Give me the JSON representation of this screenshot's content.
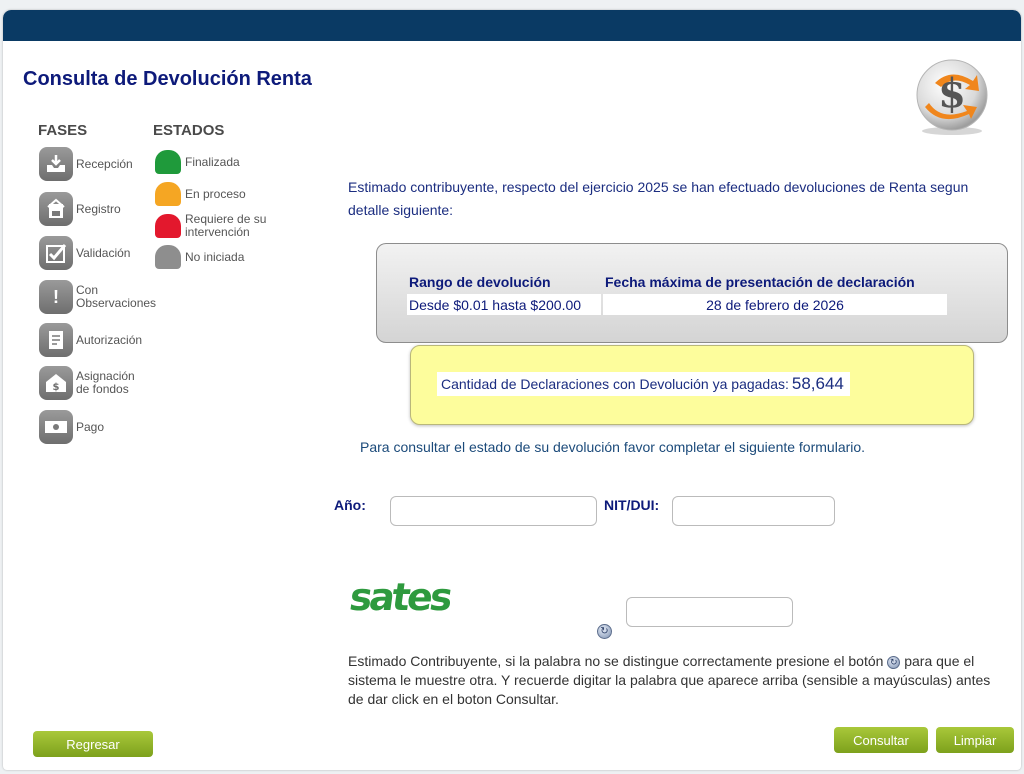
{
  "page_title": "Consulta de Devolución Renta",
  "legend": {
    "phases_title": "FASES",
    "states_title": "ESTADOS",
    "phases": [
      {
        "label": "Recepción",
        "icon": "inbox-tray-icon"
      },
      {
        "label": "Registro",
        "icon": "registry-icon"
      },
      {
        "label": "Validación",
        "icon": "checkbox-icon"
      },
      {
        "label": "Con Observaciones",
        "icon": "exclamation-icon"
      },
      {
        "label": "Autorización",
        "icon": "document-icon"
      },
      {
        "label": "Asignación de fondos",
        "icon": "money-house-icon"
      },
      {
        "label": "Pago",
        "icon": "banknote-icon"
      }
    ],
    "states": [
      {
        "label": "Finalizada",
        "color": "#1f9a3b"
      },
      {
        "label": "En proceso",
        "color": "#f5a623"
      },
      {
        "label": "Requiere de su intervención",
        "color": "#e3182d"
      },
      {
        "label": "No iniciada",
        "color": "#8e8e8e"
      }
    ]
  },
  "intro_text": "Estimado contribuyente, respecto del ejercicio 2025 se han efectuado devoluciones de Renta segun detalle siguiente:",
  "table": {
    "headers": [
      "Rango de devolución",
      "Fecha máxima de presentación de declaración"
    ],
    "rows": [
      [
        "Desde $0.01 hasta $200.00",
        "28 de febrero de 2026"
      ]
    ]
  },
  "paid": {
    "label": "Cantidad de Declaraciones con Devolución ya pagadas:",
    "value": "58,644"
  },
  "form": {
    "instructions": "Para consultar el estado de su devolución favor completar el siguiente formulario.",
    "year_label": "Año:",
    "year_value": "",
    "nit_label": "NIT/DUI:",
    "nit_value": "",
    "captcha_value": "",
    "captcha_word": "sates",
    "note_part1": "Estimado Contribuyente, si la palabra no se distingue correctamente presione el botón",
    "note_part2": "para que el sistema le muestre otra. Y recuerde digitar la palabra que aparece arriba (sensible a mayúsculas) antes de dar click en el boton Consultar."
  },
  "buttons": {
    "back": "Regresar",
    "consult": "Consultar",
    "clear": "Limpiar"
  },
  "colors": {
    "header_bar": "#0a3a64",
    "button_green": "#8db42a",
    "title_blue": "#0d1a7a"
  }
}
